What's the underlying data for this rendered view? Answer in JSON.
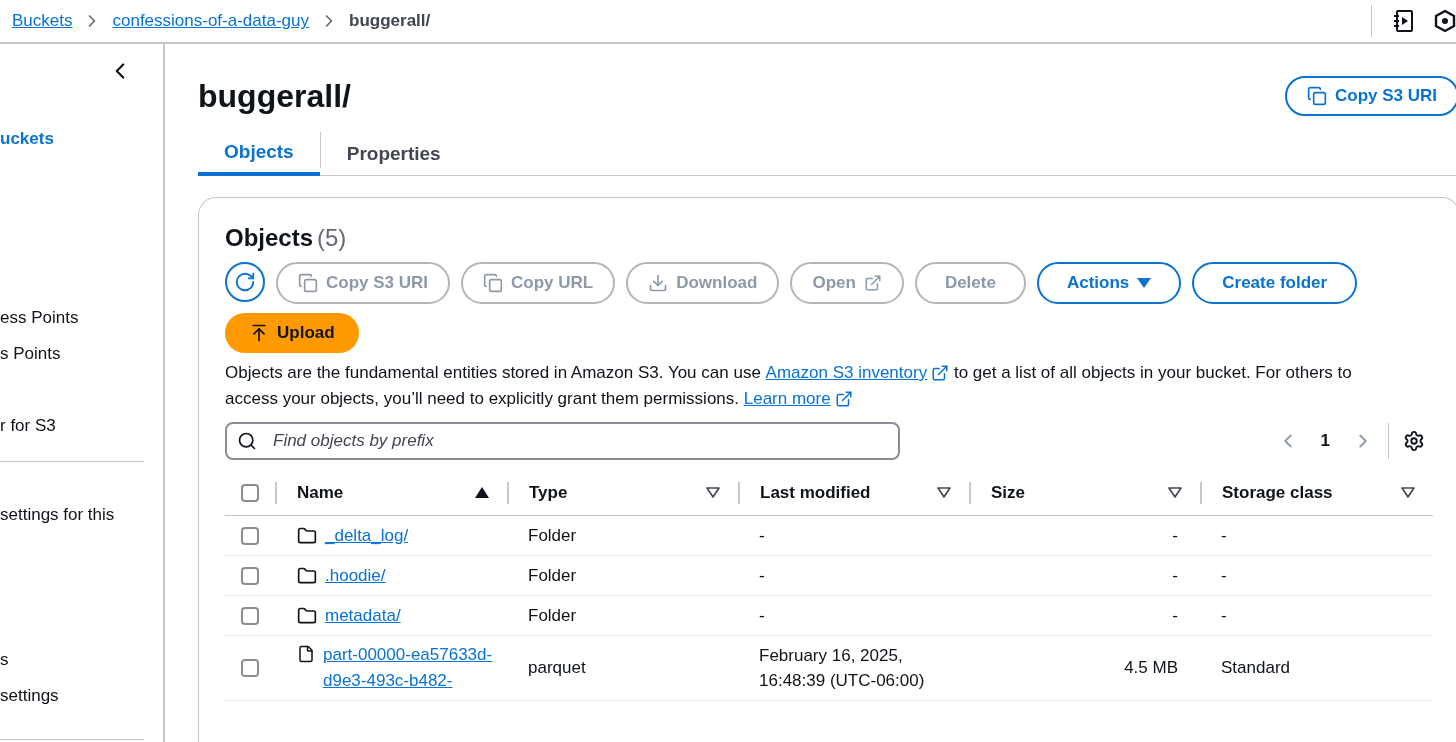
{
  "breadcrumbs": [
    {
      "label": "Buckets",
      "link": true
    },
    {
      "label": "confessions-of-a-data-guy",
      "link": true
    },
    {
      "label": "buggerall/",
      "link": false
    }
  ],
  "sidebar": {
    "items": [
      {
        "label": "uckets",
        "selected": true
      },
      {
        "label": "ess Points",
        "selected": false
      },
      {
        "label": "s Points",
        "selected": false
      },
      {
        "label": "r for S3",
        "selected": false
      },
      {
        "label": "settings for this",
        "selected": false
      },
      {
        "label": "s",
        "selected": false
      },
      {
        "label": "settings",
        "selected": false
      }
    ]
  },
  "title": "buggerall/",
  "copy_uri_button": "Copy S3 URI",
  "tabs": [
    {
      "label": "Objects",
      "selected": true
    },
    {
      "label": "Properties",
      "selected": false
    }
  ],
  "objects_panel": {
    "heading": "Objects",
    "count": "(5)",
    "actions": [
      {
        "kind": "refresh",
        "disabled": false
      },
      {
        "kind": "copy",
        "label": "Copy S3 URI",
        "disabled": true
      },
      {
        "kind": "copy",
        "label": "Copy URL",
        "disabled": true
      },
      {
        "kind": "download",
        "label": "Download",
        "disabled": true
      },
      {
        "kind": "external",
        "label": "Open",
        "disabled": true
      },
      {
        "kind": "plain",
        "label": "Delete",
        "disabled": true
      },
      {
        "kind": "dropdown",
        "label": "Actions",
        "disabled": false
      },
      {
        "kind": "plain",
        "label": "Create folder",
        "disabled": false
      },
      {
        "kind": "upload",
        "label": "Upload",
        "disabled": false
      }
    ],
    "description": {
      "before": "Objects are the fundamental entities stored in Amazon S3. You can use",
      "link1": "Amazon S3 inventory",
      "middle": "to get a list of all objects in your bucket. For others to access your objects, you’ll need to explicitly grant them permissions.",
      "link2": "Learn more"
    },
    "search": {
      "placeholder": "Find objects by prefix"
    },
    "pagination": {
      "page": "1"
    },
    "table": {
      "select_all_checked": false,
      "columns": [
        {
          "label": "Name",
          "sorted": true
        },
        {
          "label": "Type",
          "sorted": false
        },
        {
          "label": "Last modified",
          "sorted": false
        },
        {
          "label": "Size",
          "sorted": false
        },
        {
          "label": "Storage class",
          "sorted": false
        }
      ],
      "rows": [
        {
          "kind": "folder",
          "name": "_delta_log/",
          "type": "Folder",
          "modified": "-",
          "size": "-",
          "storage": "-",
          "checked": false
        },
        {
          "kind": "folder",
          "name": ".hoodie/",
          "type": "Folder",
          "modified": "-",
          "size": "-",
          "storage": "-",
          "checked": false
        },
        {
          "kind": "folder",
          "name": "metadata/",
          "type": "Folder",
          "modified": "-",
          "size": "-",
          "storage": "-",
          "checked": false
        },
        {
          "kind": "file",
          "name": "part-00000-ea57633d-d9e3-493c-b482-",
          "type": "parquet",
          "modified": "February 16, 2025, 16:48:39 (UTC-06:00)",
          "size": "4.5 MB",
          "storage": "Standard",
          "checked": false
        }
      ]
    }
  }
}
